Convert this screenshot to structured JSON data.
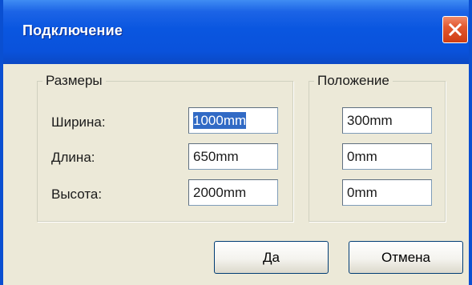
{
  "window": {
    "title": "Подключение"
  },
  "sizes": {
    "legend": "Размеры",
    "rows": [
      {
        "label": "Ширина:",
        "value": "1000mm"
      },
      {
        "label": "Длина:",
        "value": "650mm"
      },
      {
        "label": "Высота:",
        "value": "2000mm"
      }
    ]
  },
  "position": {
    "legend": "Положение",
    "values": [
      "300mm",
      "0mm",
      "0mm"
    ]
  },
  "buttons": {
    "ok": "Да",
    "cancel": "Отмена"
  },
  "icons": {
    "close": "close-icon"
  },
  "colors": {
    "titlebar": "#0a56e0",
    "close_button": "#e2582f",
    "dialog_bg": "#ece9d8",
    "selection": "#316ac5"
  }
}
